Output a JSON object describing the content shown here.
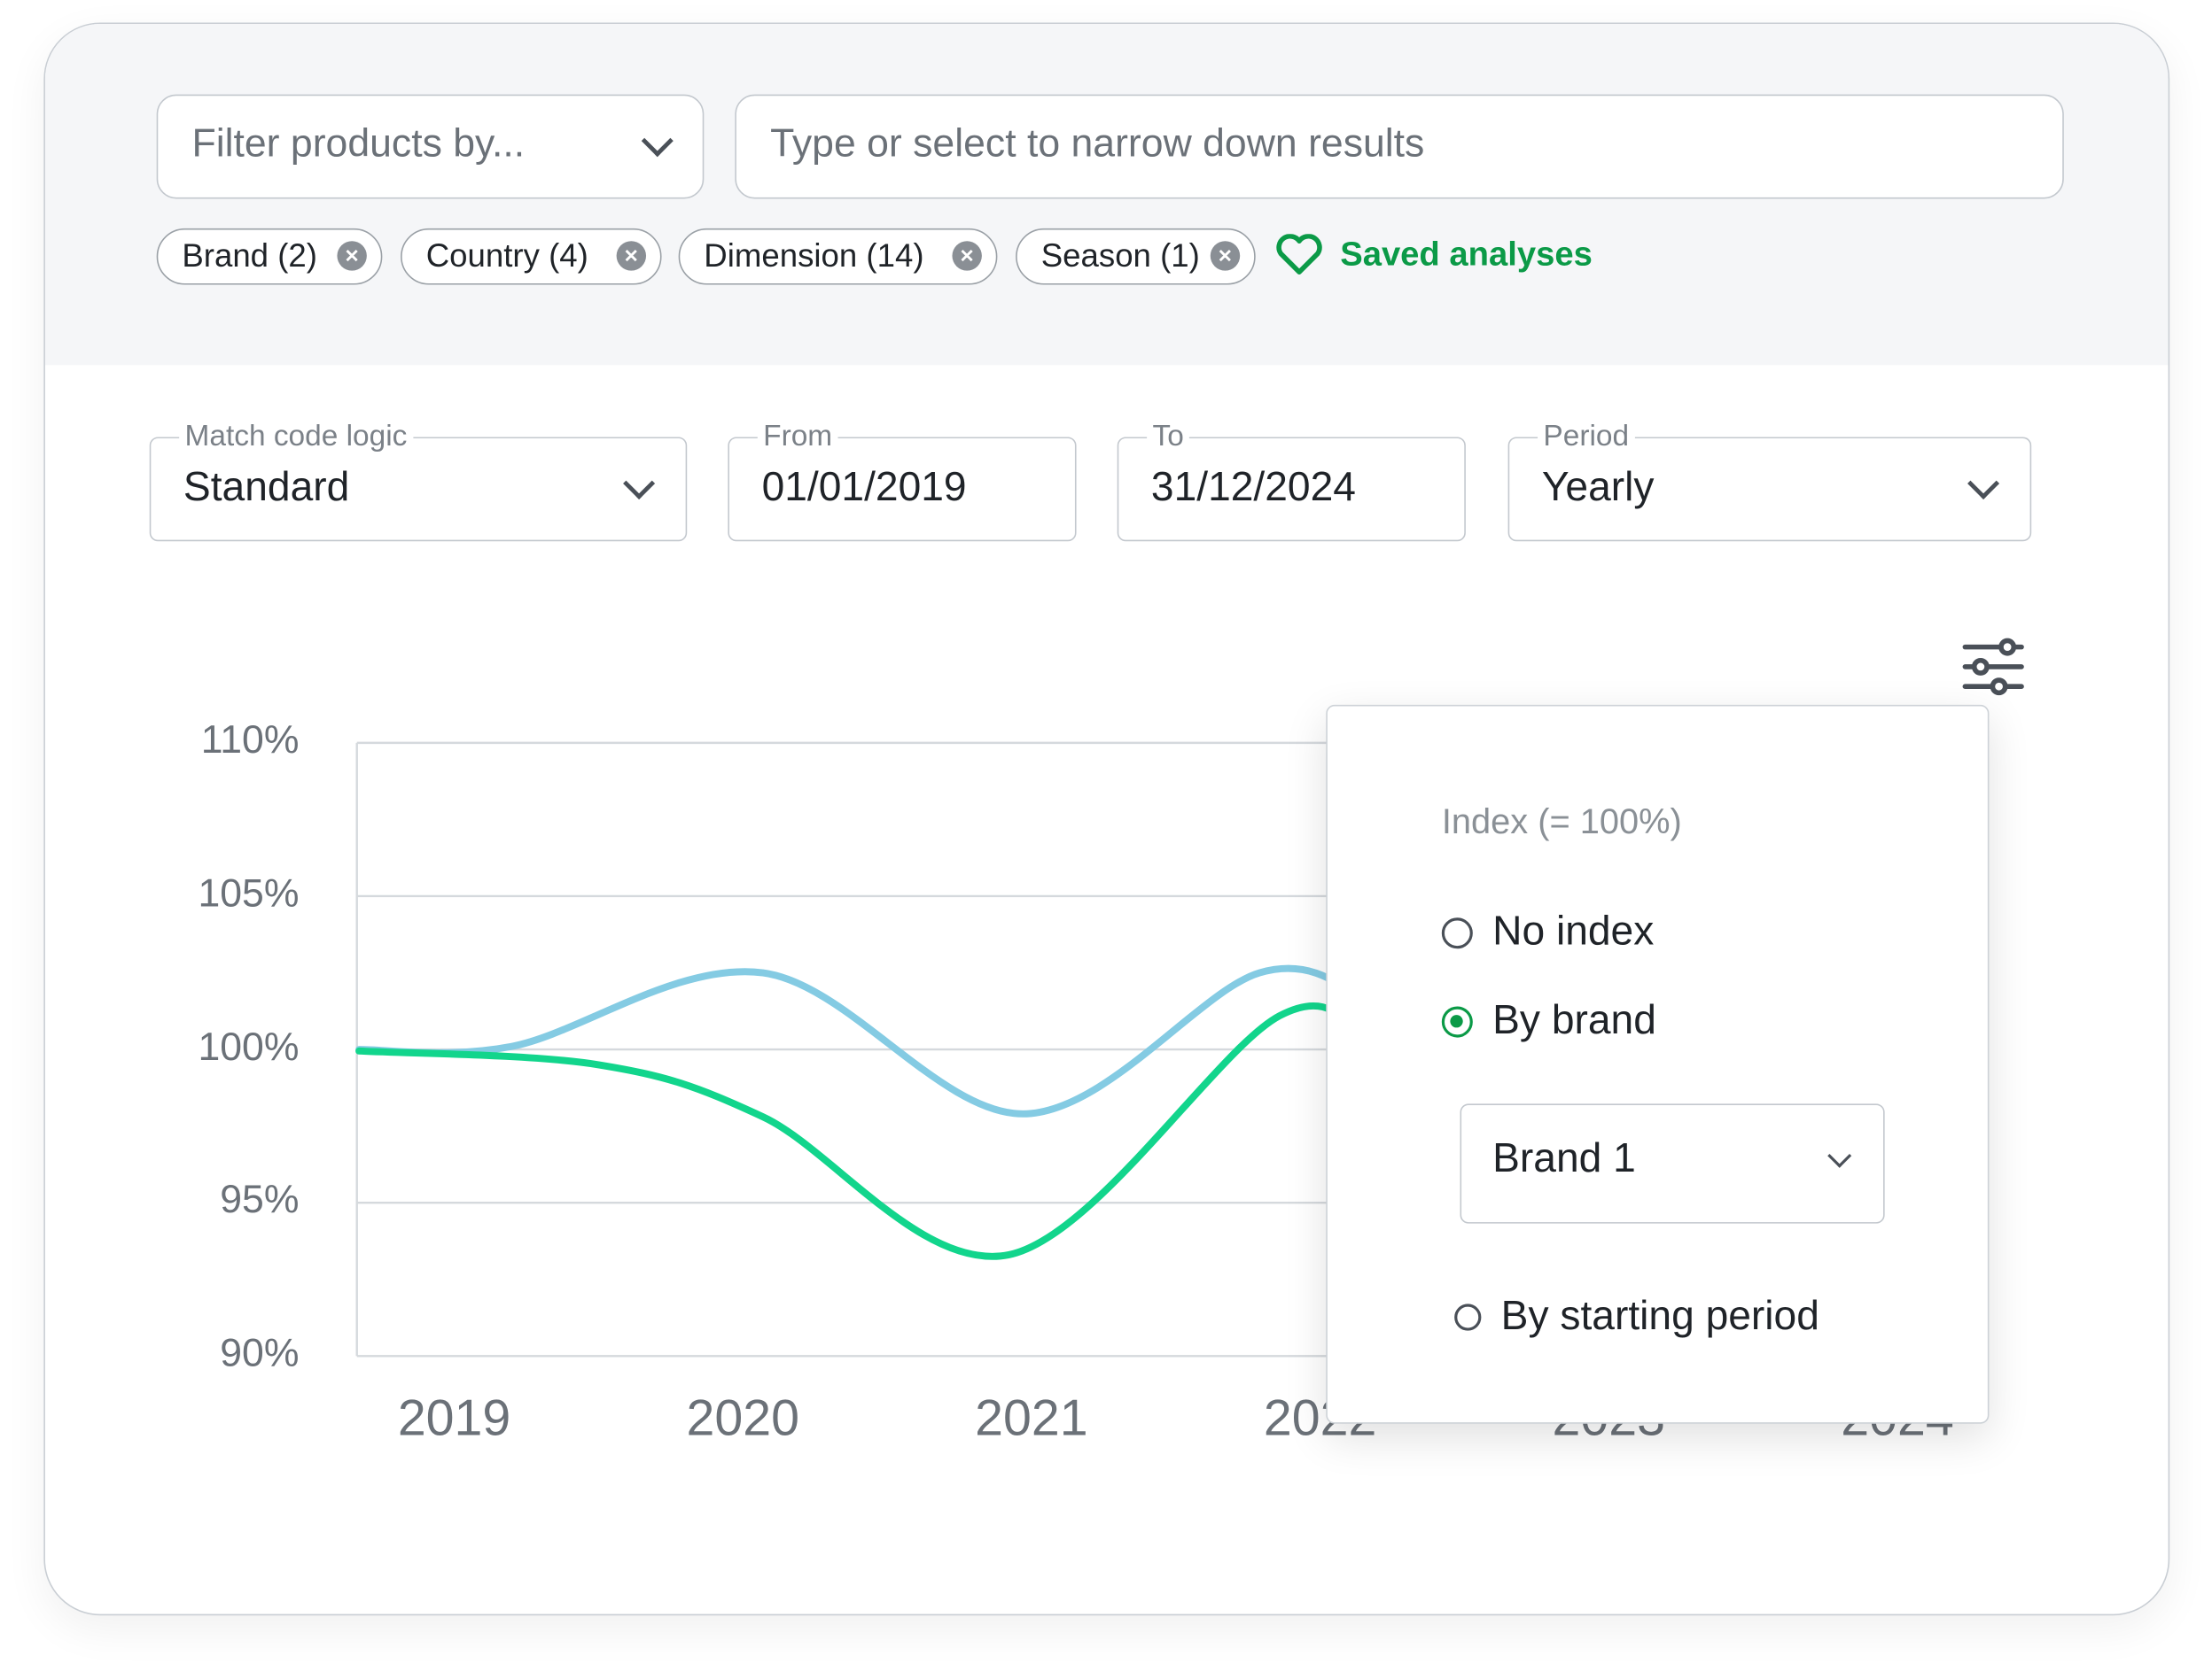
{
  "filter": {
    "select_placeholder": "Filter products by...",
    "search_placeholder": "Type or select to narrow down results"
  },
  "chips": [
    {
      "label": "Brand (2)"
    },
    {
      "label": "Country (4)"
    },
    {
      "label": "Dimension (14)"
    },
    {
      "label": "Season (1)"
    }
  ],
  "saved_analyses": {
    "label": "Saved analyses",
    "icon": "heart-icon",
    "color": "#0b9a47"
  },
  "controls": {
    "match_code_logic": {
      "label": "Match code logic",
      "value": "Standard"
    },
    "from": {
      "label": "From",
      "value": "01/01/2019"
    },
    "to": {
      "label": "To",
      "value": "31/12/2024"
    },
    "period": {
      "label": "Period",
      "value": "Yearly"
    }
  },
  "settings_icon": "sliders-icon",
  "index_popover": {
    "title": "Index (= 100%)",
    "options": [
      {
        "label": "No index",
        "selected": false
      },
      {
        "label": "By brand",
        "selected": true
      },
      {
        "label": "By starting period",
        "selected": false
      }
    ],
    "brand_select": "Brand 1"
  },
  "chart_data": {
    "type": "line",
    "x_ticks": [
      "2019",
      "2020",
      "2021",
      "2022",
      "2023",
      "2024"
    ],
    "y_ticks": [
      "110%",
      "105%",
      "100%",
      "95%",
      "90%"
    ],
    "ylim": [
      90,
      110
    ],
    "grid": true,
    "series": [
      {
        "color": "#84cbe3",
        "points": [
          [
            2018.67,
            100.0
          ],
          [
            2019.2,
            100.1
          ],
          [
            2020.07,
            102.5
          ],
          [
            2020.97,
            97.9
          ],
          [
            2021.79,
            102.5
          ],
          [
            2022.2,
            101.3
          ],
          [
            2022.4,
            99.5
          ]
        ]
      },
      {
        "color": "#12d58c",
        "points": [
          [
            2018.67,
            99.95
          ],
          [
            2019.5,
            99.5
          ],
          [
            2020.07,
            97.8
          ],
          [
            2020.92,
            93.3
          ],
          [
            2021.86,
            101.1
          ],
          [
            2022.2,
            99.6
          ],
          [
            2022.4,
            96.5
          ]
        ]
      }
    ]
  }
}
